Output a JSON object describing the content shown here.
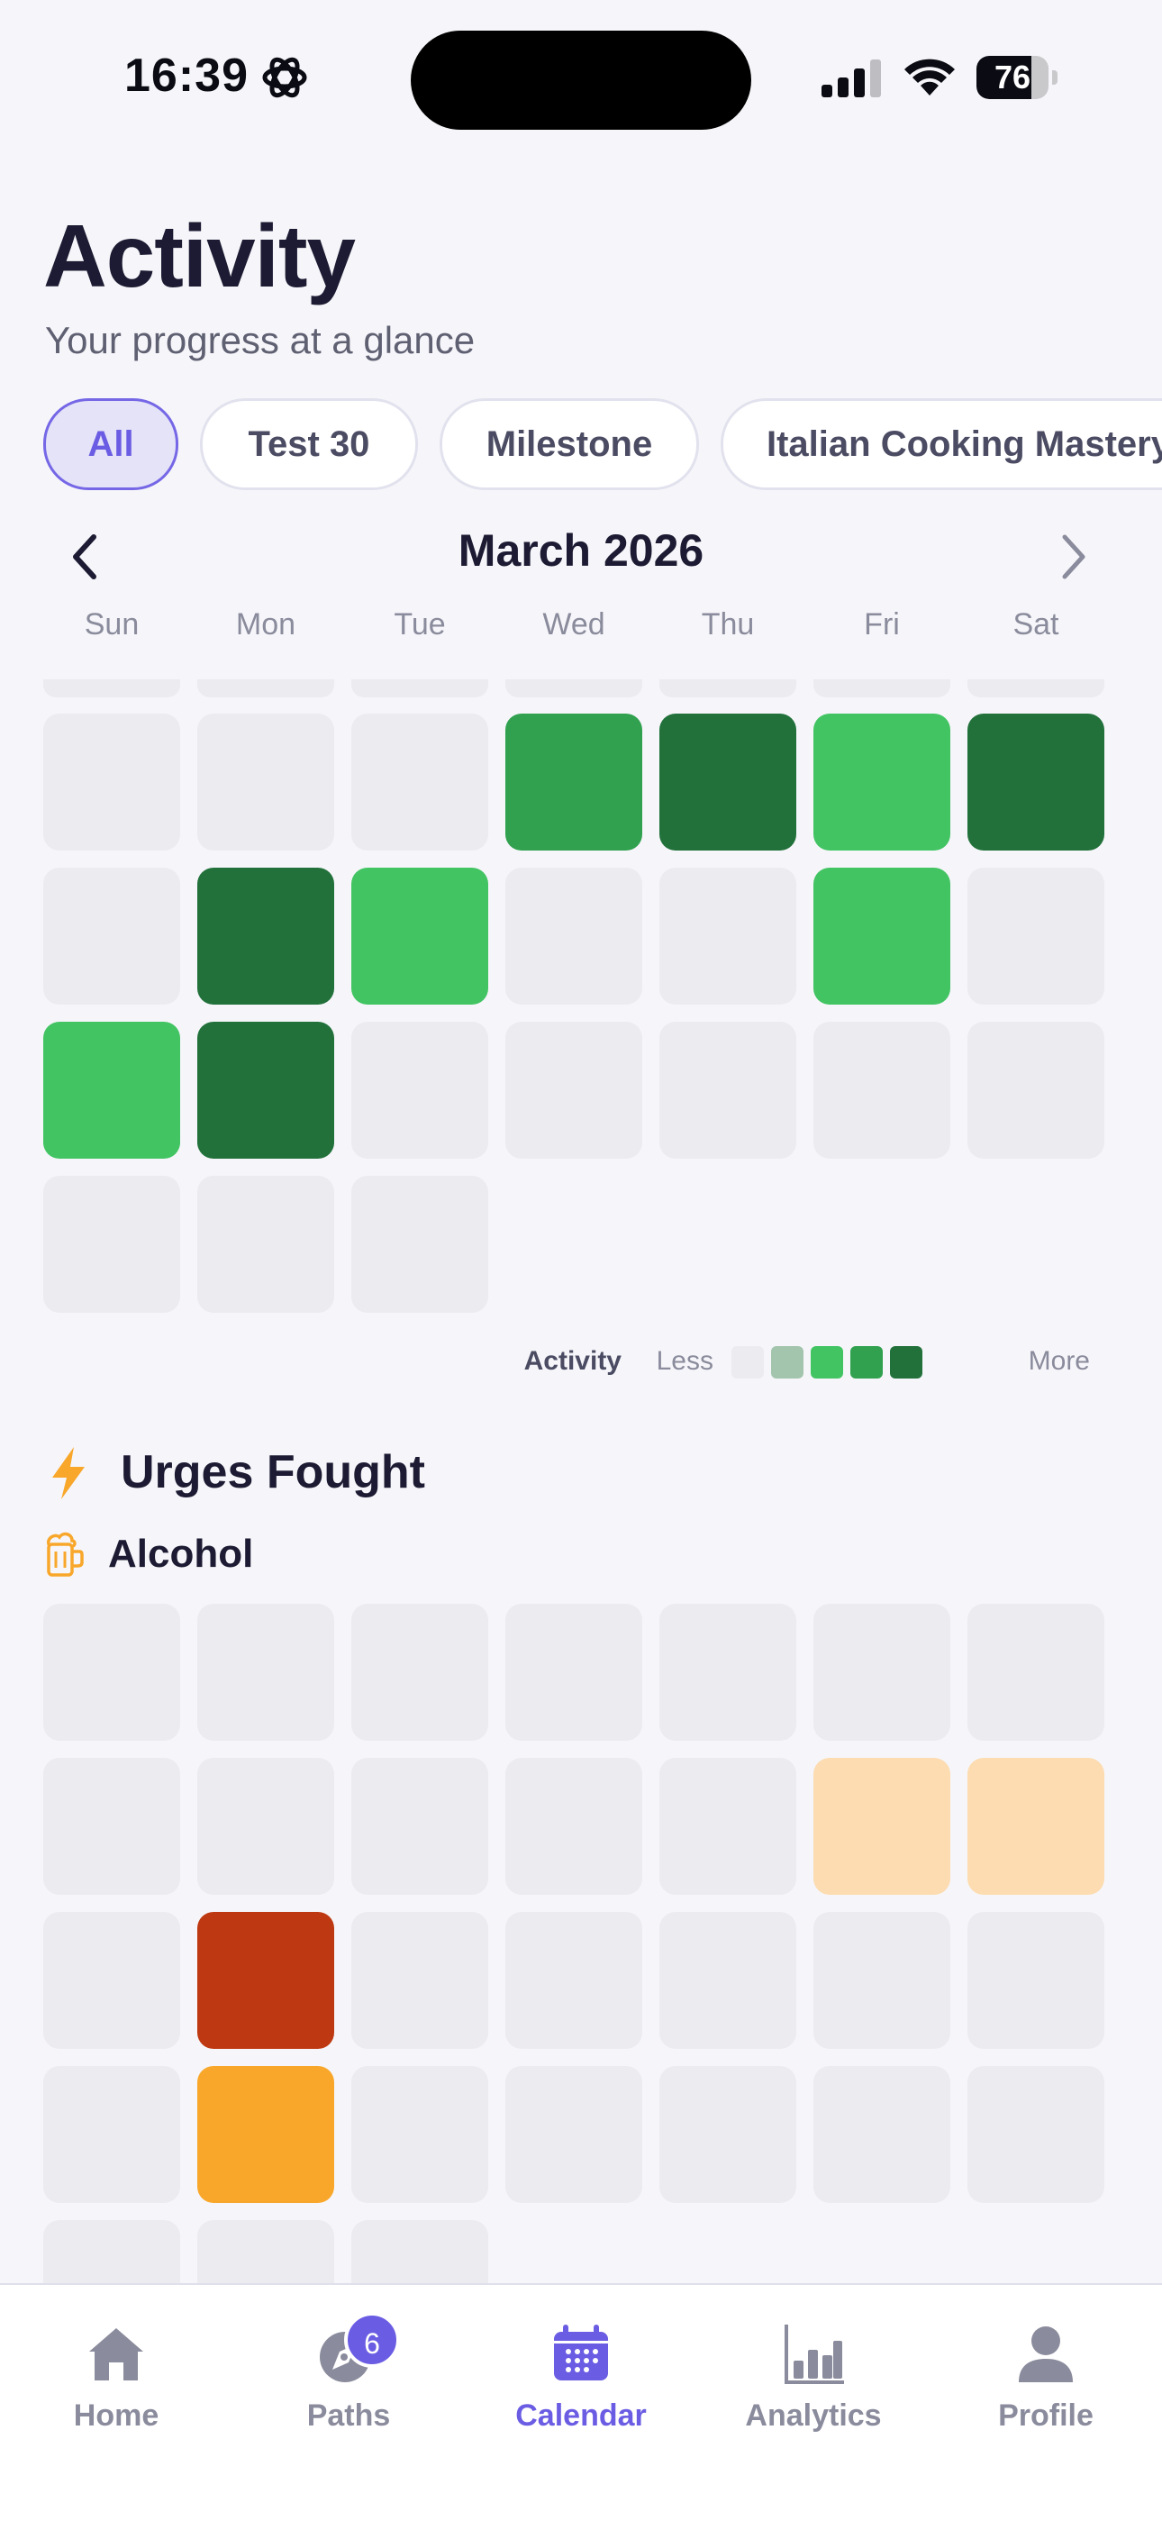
{
  "status": {
    "time": "16:39",
    "battery": "76",
    "battery_level": 0.76
  },
  "header": {
    "title": "Activity",
    "subtitle": "Your progress at a glance"
  },
  "filters": [
    {
      "label": "All",
      "active": true
    },
    {
      "label": "Test 30",
      "active": false
    },
    {
      "label": "Milestone",
      "active": false
    },
    {
      "label": "Italian Cooking Mastery",
      "active": false
    }
  ],
  "calendar": {
    "month": "March 2026",
    "weekdays": [
      "Sun",
      "Mon",
      "Tue",
      "Wed",
      "Thu",
      "Fri",
      "Sat"
    ],
    "activity_grid": [
      [
        0,
        0,
        0,
        3,
        4,
        2,
        4
      ],
      [
        0,
        4,
        2,
        0,
        0,
        2,
        0
      ],
      [
        2,
        4,
        0,
        0,
        0,
        0,
        0
      ],
      [
        0,
        0,
        0,
        null,
        null,
        null,
        null
      ]
    ],
    "activity_colors": [
      "#ebebf0",
      "#a3c4ad",
      "#42c463",
      "#31a14f",
      "#22713b"
    ]
  },
  "legend": {
    "label": "Activity",
    "less": "Less",
    "more": "More"
  },
  "urges": {
    "title": "Urges Fought",
    "category": "Alcohol",
    "grid": [
      [
        0,
        0,
        0,
        0,
        0,
        0,
        0
      ],
      [
        0,
        0,
        0,
        0,
        0,
        1,
        1
      ],
      [
        0,
        3,
        0,
        0,
        0,
        0,
        0
      ],
      [
        0,
        2,
        0,
        0,
        0,
        0,
        0
      ]
    ],
    "colors": [
      "#ebebf0",
      "#fcdcb0",
      "#f8a72b",
      "#be3911"
    ]
  },
  "tabs": [
    {
      "label": "Home",
      "icon": "home-icon",
      "active": false
    },
    {
      "label": "Paths",
      "icon": "compass-icon",
      "active": false,
      "badge": "6"
    },
    {
      "label": "Calendar",
      "icon": "calendar-icon",
      "active": true
    },
    {
      "label": "Analytics",
      "icon": "bar-chart-icon",
      "active": false
    },
    {
      "label": "Profile",
      "icon": "person-icon",
      "active": false
    }
  ]
}
